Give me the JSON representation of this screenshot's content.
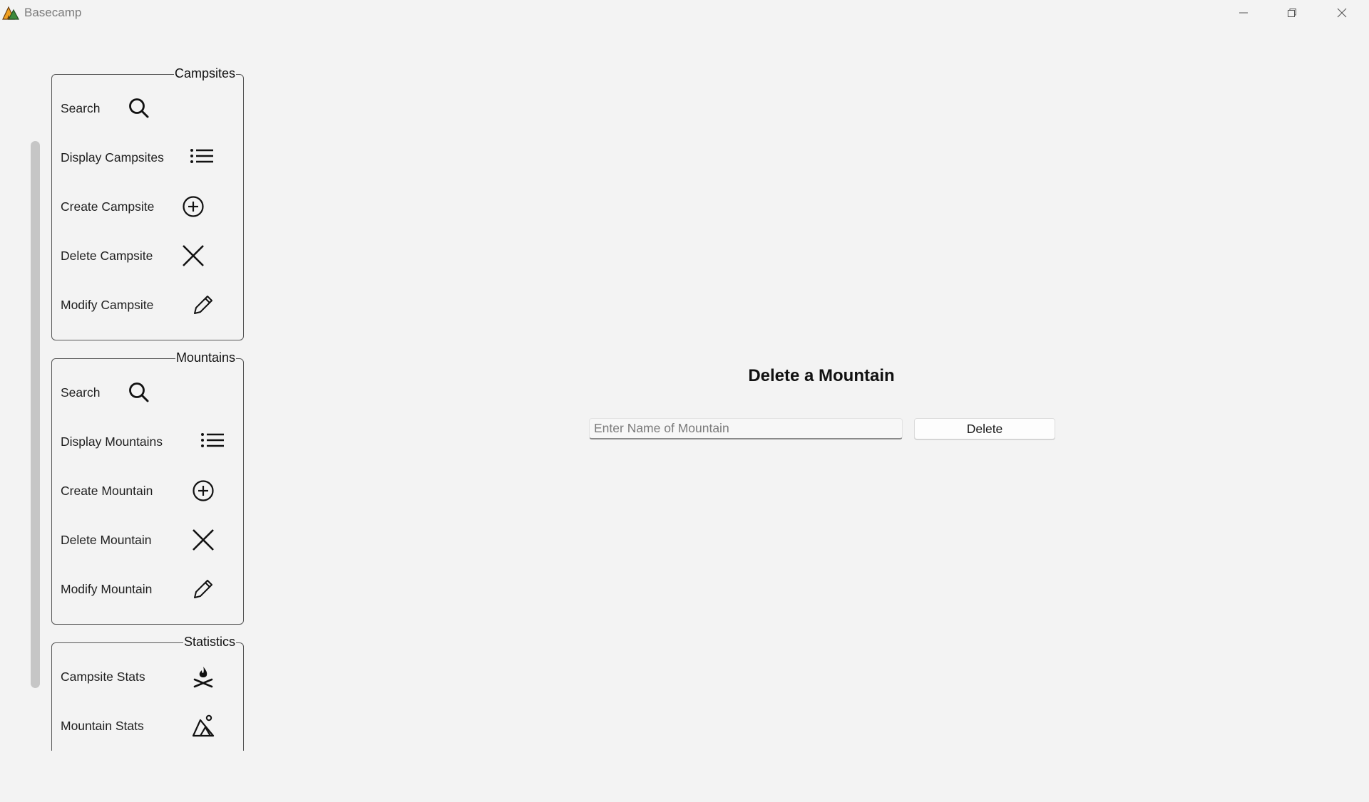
{
  "window": {
    "title": "Basecamp",
    "controls": [
      "minimize-icon",
      "maximize-icon",
      "close-icon"
    ]
  },
  "sidebar": {
    "groups": [
      {
        "title": "Campsites",
        "items": [
          {
            "label": "Search",
            "icon": "search-icon"
          },
          {
            "label": "Display Campsites",
            "icon": "list-icon"
          },
          {
            "label": "Create Campsite",
            "icon": "add-circle-icon"
          },
          {
            "label": "Delete Campsite",
            "icon": "close-icon"
          },
          {
            "label": "Modify Campsite",
            "icon": "pencil-icon"
          }
        ]
      },
      {
        "title": "Mountains",
        "items": [
          {
            "label": "Search",
            "icon": "search-icon"
          },
          {
            "label": "Display Mountains",
            "icon": "list-icon"
          },
          {
            "label": "Create Mountain",
            "icon": "add-circle-icon"
          },
          {
            "label": "Delete Mountain",
            "icon": "close-icon"
          },
          {
            "label": "Modify Mountain",
            "icon": "pencil-icon"
          }
        ]
      },
      {
        "title": "Statistics",
        "items": [
          {
            "label": "Campsite Stats",
            "icon": "campfire-icon"
          },
          {
            "label": "Mountain Stats",
            "icon": "mountain-icon"
          }
        ]
      }
    ]
  },
  "main": {
    "title": "Delete a Mountain",
    "input": {
      "placeholder": "Enter Name of Mountain",
      "value": ""
    },
    "button_label": "Delete"
  }
}
